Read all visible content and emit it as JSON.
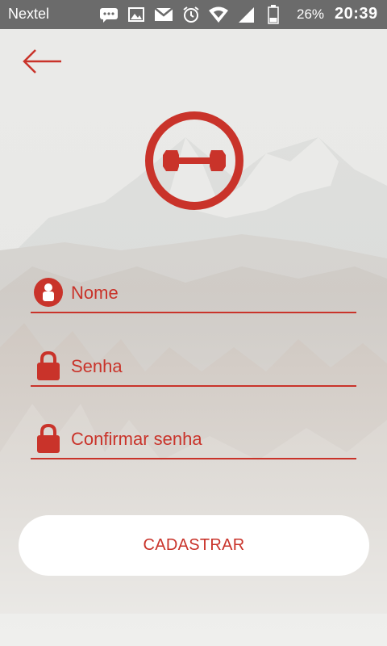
{
  "status_bar": {
    "carrier": "Nextel",
    "battery_percent": "26%",
    "time": "20:39",
    "icons": [
      "message-icon",
      "image-icon",
      "gmail-icon",
      "alarm-icon",
      "wifi-icon",
      "signal-icon",
      "battery-icon"
    ]
  },
  "colors": {
    "accent": "#c9332a",
    "status_bar": "#6b6b6b",
    "button_bg": "#ffffff"
  },
  "form": {
    "name_placeholder": "Nome",
    "password_placeholder": "Senha",
    "confirm_placeholder": "Confirmar senha",
    "submit_label": "CADASTRAR"
  }
}
